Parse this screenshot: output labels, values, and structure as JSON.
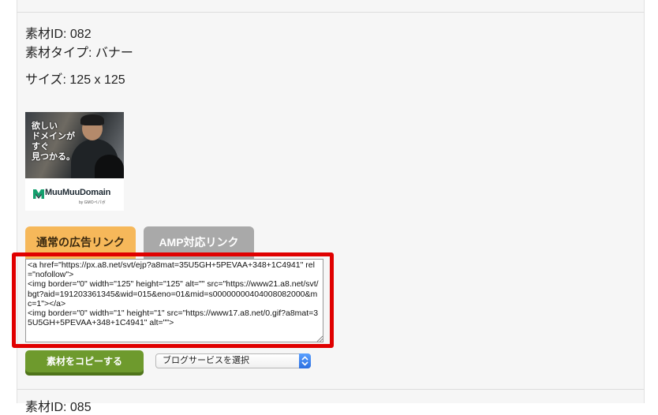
{
  "item": {
    "id_label": "素材ID: 082",
    "type_label": "素材タイプ: バナー",
    "size_label": "サイズ: 125 x 125"
  },
  "banner": {
    "copy_lines": [
      "欲しい",
      "ドメインが",
      "すぐ",
      "見つかる。"
    ],
    "logo_text": "MuuMuuDomain",
    "logo_sub": "by GMOペパボ"
  },
  "tabs": {
    "normal_label": "通常の広告リンク",
    "amp_label": "AMP対応リンク",
    "active": "normal"
  },
  "code": {
    "text": "<a href=\"https://px.a8.net/svt/ejp?a8mat=35U5GH+5PEVAA+348+1C4941\" rel=\"nofollow\">\n<img border=\"0\" width=\"125\" height=\"125\" alt=\"\" src=\"https://www21.a8.net/svt/bgt?aid=191203361345&wid=015&eno=01&mid=s00000000404008082000&mc=1\"></a>\n<img border=\"0\" width=\"1\" height=\"1\" src=\"https://www17.a8.net/0.gif?a8mat=35U5GH+5PEVAA+348+1C4941\" alt=\"\">"
  },
  "actions": {
    "copy_label": "素材をコピーする",
    "blog_select_value": "ブログサービスを選択"
  },
  "next_item": {
    "id_label_partial": "素材ID: 085"
  },
  "colors": {
    "tab_active": "#f6b85a",
    "tab_inactive": "#a9a9a9",
    "copy_button": "#6e9a2d",
    "highlight": "#e00000"
  }
}
